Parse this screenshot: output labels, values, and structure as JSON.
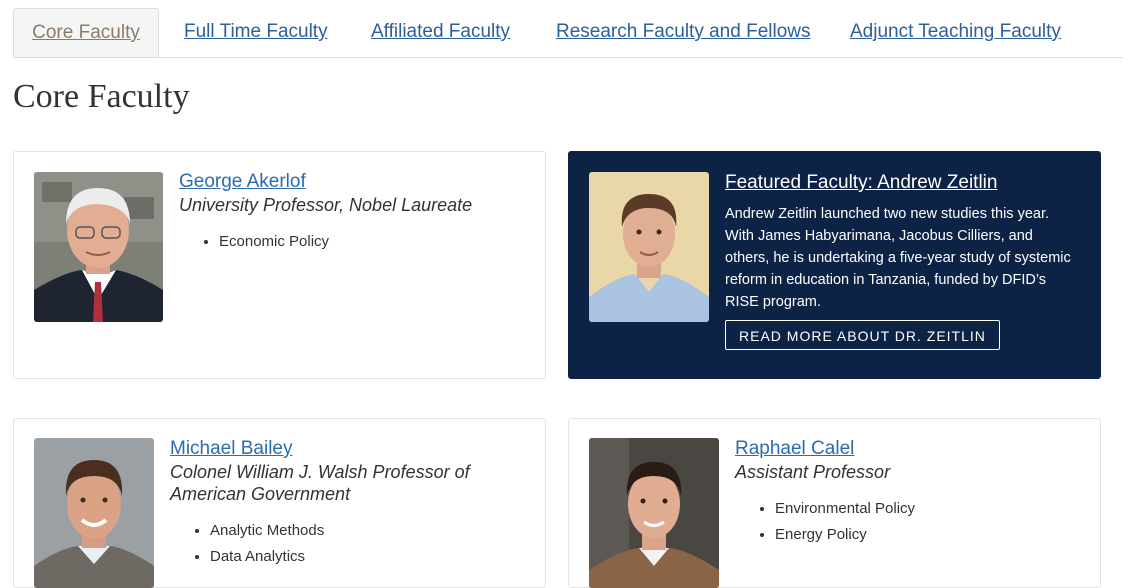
{
  "tabs": [
    {
      "label": "Core Faculty",
      "active": true
    },
    {
      "label": "Full Time Faculty",
      "active": false
    },
    {
      "label": "Affiliated Faculty",
      "active": false
    },
    {
      "label": "Research Faculty and Fellows",
      "active": false
    },
    {
      "label": "Adjunct Teaching Faculty",
      "active": false
    }
  ],
  "page_title": "Core Faculty",
  "faculty": [
    {
      "name": "George Akerlof",
      "role": "University Professor, Nobel Laureate",
      "tags": [
        "Economic Policy"
      ]
    },
    {
      "name": "Michael Bailey",
      "role": "Colonel William J. Walsh Professor of American Government",
      "tags": [
        "Analytic Methods",
        "Data Analytics"
      ]
    },
    {
      "name": "Raphael Calel",
      "role": "Assistant Professor",
      "tags": [
        "Environmental Policy",
        "Energy Policy"
      ]
    }
  ],
  "featured": {
    "title": "Featured Faculty: Andrew Zeitlin",
    "text": "Andrew Zeitlin launched two new studies this year. With James Habyarimana, Jacobus Cilliers, and others, he is undertaking a five-year study of systemic reform in education in Tanzania, funded by DFID’s RISE program.",
    "button": "READ MORE ABOUT DR. ZEITLIN"
  },
  "colors": {
    "link": "#2b6cb0",
    "featured_bg": "#0c2346",
    "active_tab_text": "#8a7c69"
  }
}
